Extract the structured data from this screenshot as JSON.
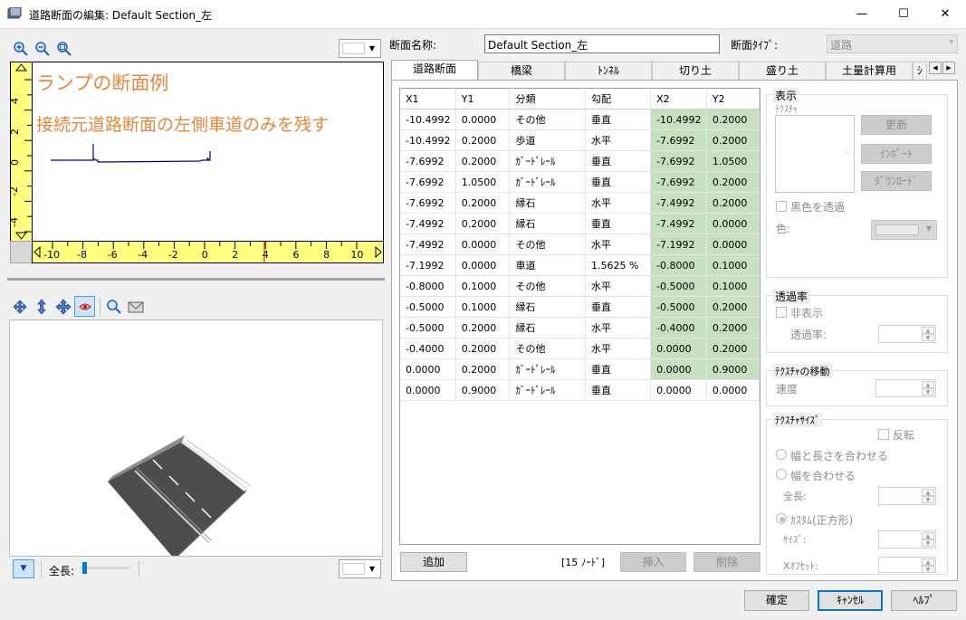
{
  "window": {
    "title": "道路断面の編集: Default Section_左",
    "minimize": "—",
    "maximize": "☐",
    "close": "✕"
  },
  "section_view": {
    "annotation_title": "ランプの断面例",
    "annotation_note": "接続元道路断面の左側車道のみを残す",
    "y_ticks": [
      "4",
      "2",
      "0",
      "-2",
      "-4"
    ],
    "x_ticks": [
      "-10",
      "-8",
      "-6",
      "-4",
      "-2",
      "0",
      "2",
      "4",
      "6",
      "8",
      "10"
    ],
    "line_color": "#00008b",
    "marker_color": "#ff0000"
  },
  "view3d": {
    "length_label": "全長:"
  },
  "form": {
    "name_label": "断面名称:",
    "name_value": "Default Section_左",
    "type_label": "断面ﾀｲﾌﾟ:",
    "type_value": "道路"
  },
  "tabs": [
    "道路断面",
    "橋梁",
    "ﾄﾝﾈﾙ",
    "切り土",
    "盛り土",
    "土量計算用",
    "ｼ"
  ],
  "table": {
    "headers": [
      "X1",
      "Y1",
      "分類",
      "勾配",
      "X2",
      "Y2"
    ],
    "rows": [
      [
        "-10.4992",
        "0.0000",
        "その他",
        "垂直",
        "-10.4992",
        "0.2000"
      ],
      [
        "-10.4992",
        "0.2000",
        "歩道",
        "水平",
        "-7.6992",
        "0.2000"
      ],
      [
        "-7.6992",
        "0.2000",
        "ｶﾞｰﾄﾞﾚｰﾙ",
        "垂直",
        "-7.6992",
        "1.0500"
      ],
      [
        "-7.6992",
        "1.0500",
        "ｶﾞｰﾄﾞﾚｰﾙ",
        "垂直",
        "-7.6992",
        "0.2000"
      ],
      [
        "-7.6992",
        "0.2000",
        "縁石",
        "水平",
        "-7.4992",
        "0.2000"
      ],
      [
        "-7.4992",
        "0.2000",
        "縁石",
        "垂直",
        "-7.4992",
        "0.0000"
      ],
      [
        "-7.4992",
        "0.0000",
        "その他",
        "水平",
        "-7.1992",
        "0.0000"
      ],
      [
        "-7.1992",
        "0.0000",
        "車道",
        "1.5625 %",
        "-0.8000",
        "0.1000"
      ],
      [
        "-0.8000",
        "0.1000",
        "その他",
        "水平",
        "-0.5000",
        "0.1000"
      ],
      [
        "-0.5000",
        "0.1000",
        "縁石",
        "垂直",
        "-0.5000",
        "0.2000"
      ],
      [
        "-0.5000",
        "0.2000",
        "縁石",
        "水平",
        "-0.4000",
        "0.2000"
      ],
      [
        "-0.4000",
        "0.2000",
        "その他",
        "水平",
        "0.0000",
        "0.2000"
      ],
      [
        "0.0000",
        "0.2000",
        "ｶﾞｰﾄﾞﾚｰﾙ",
        "垂直",
        "0.0000",
        "0.9000"
      ],
      [
        "0.0000",
        "0.9000",
        "ｶﾞｰﾄﾞﾚｰﾙ",
        "垂直",
        "0.0000",
        "0.0000"
      ]
    ],
    "highlighted_rows": 13,
    "add_button": "追加",
    "node_count": "[15 ﾉｰﾄﾞ]",
    "insert_button": "挿入",
    "delete_button": "削除"
  },
  "display_group": {
    "title": "表示",
    "texture_label": "ﾃｸｽﾁｬ",
    "update_button": "更新",
    "import_button": "ｲﾝﾎﾟｰﾄ",
    "download_button": "ﾀﾞｳﾝﾛｰﾄﾞ",
    "black_transparent_label": "黒色を透過",
    "color_label": "色:"
  },
  "transparency_group": {
    "title": "透過率",
    "hide_label": "非表示",
    "rate_label": "透過率:"
  },
  "texture_move_group": {
    "title": "ﾃｸｽﾁｬの移動",
    "speed_label": "速度"
  },
  "texture_size_group": {
    "title": "ﾃｸｽﾁｬｻｲｽﾞ",
    "flip_label": "反転",
    "fit_both_label": "幅と長さを合わせる",
    "fit_width_label": "幅を合わせる",
    "full_length_label": "全長:",
    "custom_label": "ｶｽﾀﾑ(正方形)",
    "size_label": "ｻｲｽﾞ:",
    "x_offset_label": "Xｵﾌｾｯﾄ:"
  },
  "footer": {
    "ok": "確定",
    "cancel": "ｷｬﾝｾﾙ",
    "help": "ﾍﾙﾌﾟ"
  }
}
